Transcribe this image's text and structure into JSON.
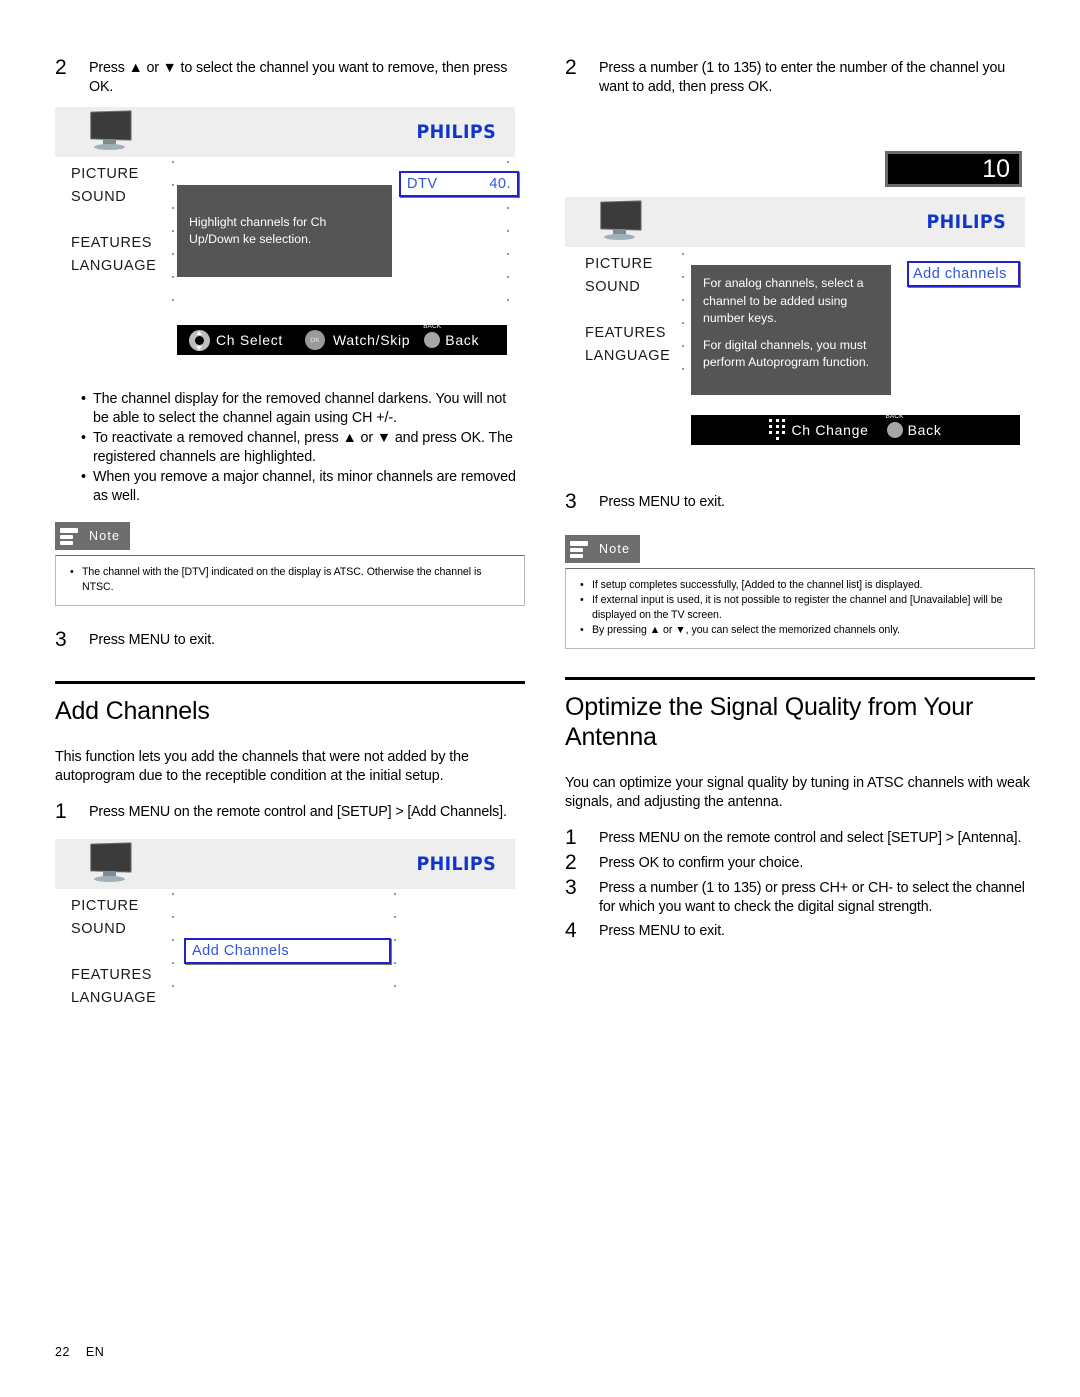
{
  "footer": {
    "page_number": "22",
    "language_code": "EN"
  },
  "brand": "PHILIPS",
  "left_column": {
    "step2": {
      "number": "2",
      "text": "Press ▲ or ▼ to select the channel you want to remove, then press OK."
    },
    "tv_screen_1": {
      "menu_items": [
        "PICTURE",
        "SOUND",
        "FEATURES",
        "LANGUAGE"
      ],
      "osd_message": "Highlight channels for Ch Up/Down ke selection.",
      "highlight": {
        "label": "DTV",
        "value": "40."
      },
      "navbar": [
        {
          "icon": "dpad-icon",
          "label": "Ch Select"
        },
        {
          "icon": "ok-button-icon",
          "icon_text": "OK",
          "label": "Watch/Skip"
        },
        {
          "icon": "back-button-icon",
          "icon_text": "BACK",
          "label": "Back"
        }
      ]
    },
    "bullets": [
      "The channel display for the removed channel darkens. You will not be able to select the channel again using CH +/-.",
      "To reactivate a removed channel, press ▲ or ▼ and press OK. The registered channels are highlighted.",
      "When you remove a major channel, its minor channels are removed as well."
    ],
    "note": {
      "title": "Note",
      "items": [
        "The channel with the [DTV] indicated on the display is ATSC. Otherwise the channel is NTSC."
      ]
    },
    "step3": {
      "number": "3",
      "text": "Press MENU to exit."
    },
    "section": {
      "heading": "Add Channels",
      "intro": "This function lets you add the channels that were not added by the autoprogram due to the receptible condition at the initial setup.",
      "step1": {
        "number": "1",
        "text": "Press MENU on the remote control and [SETUP] > [Add Channels]."
      }
    },
    "tv_screen_2": {
      "menu_items": [
        "PICTURE",
        "SOUND",
        "FEATURES",
        "LANGUAGE"
      ],
      "highlight": {
        "label": "Add Channels"
      }
    }
  },
  "right_column": {
    "step2": {
      "number": "2",
      "text": "Press a number (1 to 135) to enter the number of the channel you want to add, then press OK."
    },
    "channel_badge": {
      "value": "10"
    },
    "tv_screen_3": {
      "menu_items": [
        "PICTURE",
        "SOUND",
        "FEATURES",
        "LANGUAGE"
      ],
      "osd_message_1": "For analog channels, select a channel to be added using number keys.",
      "osd_message_2": "For digital channels, you must perform Autoprogram function.",
      "highlight": {
        "label": "Add channels"
      },
      "navbar": [
        {
          "icon": "keypad-icon",
          "label": "Ch Change"
        },
        {
          "icon": "back-button-icon",
          "icon_text": "BACK",
          "label": "Back"
        }
      ]
    },
    "step3": {
      "number": "3",
      "text": "Press MENU to exit."
    },
    "note": {
      "title": "Note",
      "items": [
        "If setup completes successfully, [Added to the channel list] is displayed.",
        "If external input is used, it is not possible to register the channel and [Unavailable] will be displayed on the TV screen.",
        "By pressing ▲ or ▼, you can select the memorized channels only."
      ]
    },
    "section": {
      "heading": "Optimize the Signal Quality from Your Antenna",
      "intro": "You can optimize your signal quality by tuning in ATSC channels with weak signals, and adjusting the antenna.",
      "steps": [
        {
          "number": "1",
          "text": "Press MENU on the remote control and select [SETUP] > [Antenna]."
        },
        {
          "number": "2",
          "text": "Press OK to confirm your choice."
        },
        {
          "number": "3",
          "text": "Press a number (1 to 135) or press CH+ or CH- to select the channel for which you want to check the digital signal strength."
        },
        {
          "number": "4",
          "text": "Press MENU to exit."
        }
      ]
    }
  }
}
